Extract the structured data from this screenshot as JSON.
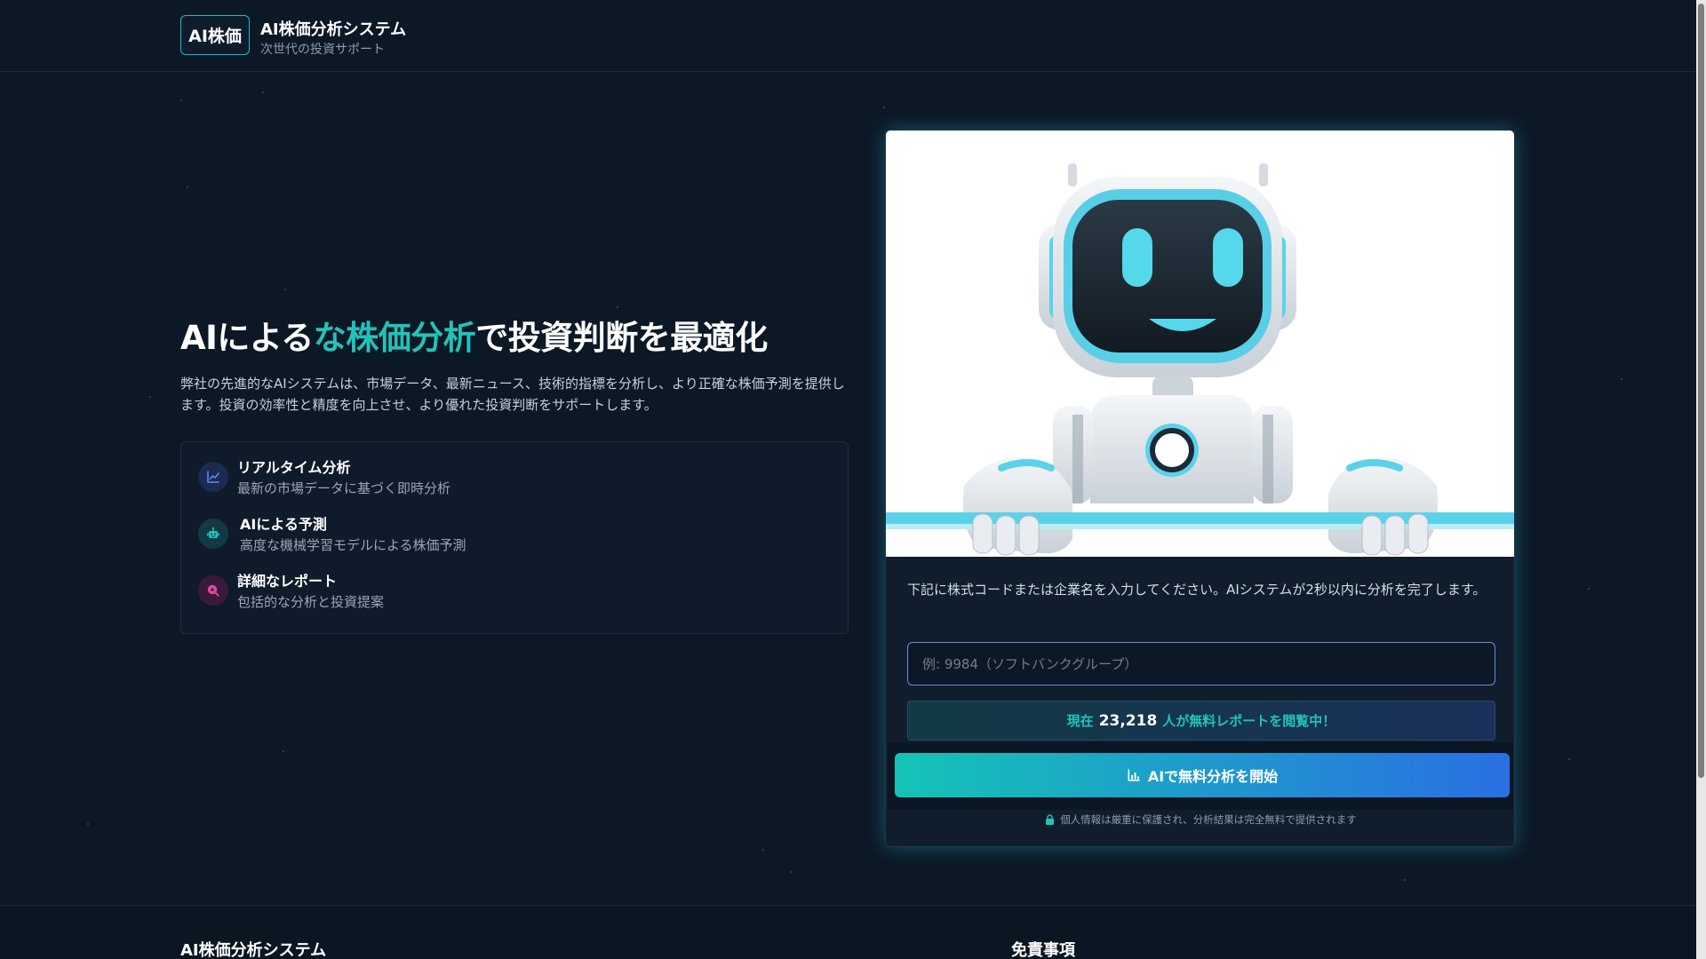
{
  "header": {
    "logo": "AI株価",
    "title": "AI株価分析システム",
    "subtitle": "次世代の投資サポート"
  },
  "hero": {
    "title_before": "AIによる",
    "title_highlight": "な株価分析",
    "title_after": "で投資判断を最適化",
    "description": "弊社の先進的なAIシステムは、市場データ、最新ニュース、技術的指標を分析し、より正確な株価予測を提供します。投資の効率性と精度を向上させ、より優れた投資判断をサポートします。"
  },
  "features": [
    {
      "icon": "chart-line-icon",
      "title": "リアルタイム分析",
      "desc": "最新の市場データに基づく即時分析",
      "color": "#3b6fd6",
      "bg": "#1a2a52"
    },
    {
      "icon": "robot-icon",
      "title": "AIによる予測",
      "desc": "高度な機械学習モデルによる株価予測",
      "color": "#22c3b8",
      "bg": "#133a44"
    },
    {
      "icon": "search-icon",
      "title": "詳細なレポート",
      "desc": "包括的な分析と投資提案",
      "color": "#e0479a",
      "bg": "#3a1a3a"
    }
  ],
  "card": {
    "description": "下記に株式コードまたは企業名を入力してください。AIシステムが2秒以内に分析を完了します。",
    "input_placeholder": "例: 9984（ソフトバンクグループ）",
    "input_value": "",
    "live_prefix": "現在",
    "live_count": "23,218",
    "live_suffix": "人が無料レポートを閲覧中！",
    "cta_label": "AIで無料分析を開始",
    "privacy": "個人情報は厳重に保護され、分析結果は完全無料で提供されます"
  },
  "footer": {
    "left_title": "AI株価分析システム",
    "right_title": "免責事項"
  },
  "colors": {
    "background": "#0d1826",
    "accent": "#22c3b8",
    "cta_start": "#14c4b6",
    "cta_end": "#2a6fe3"
  }
}
